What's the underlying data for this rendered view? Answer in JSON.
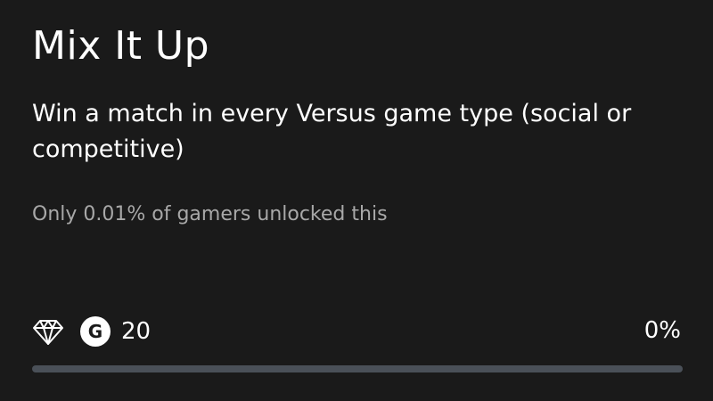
{
  "achievement": {
    "title": "Mix It Up",
    "description": "Win a match in every Versus game type (social or competitive)",
    "rarity_text": "Only 0.01% of gamers unlocked this",
    "gamerscore_badge": "G",
    "gamerscore": "20",
    "progress_text": "0%",
    "progress_fraction": 0,
    "icons": {
      "rare": "diamond-icon",
      "gamerscore": "gamerscore-g-icon"
    },
    "colors": {
      "background": "#1a1a1a",
      "text": "#ffffff",
      "muted_text": "#a8a8a8",
      "progress_track": "#4a5058"
    }
  }
}
